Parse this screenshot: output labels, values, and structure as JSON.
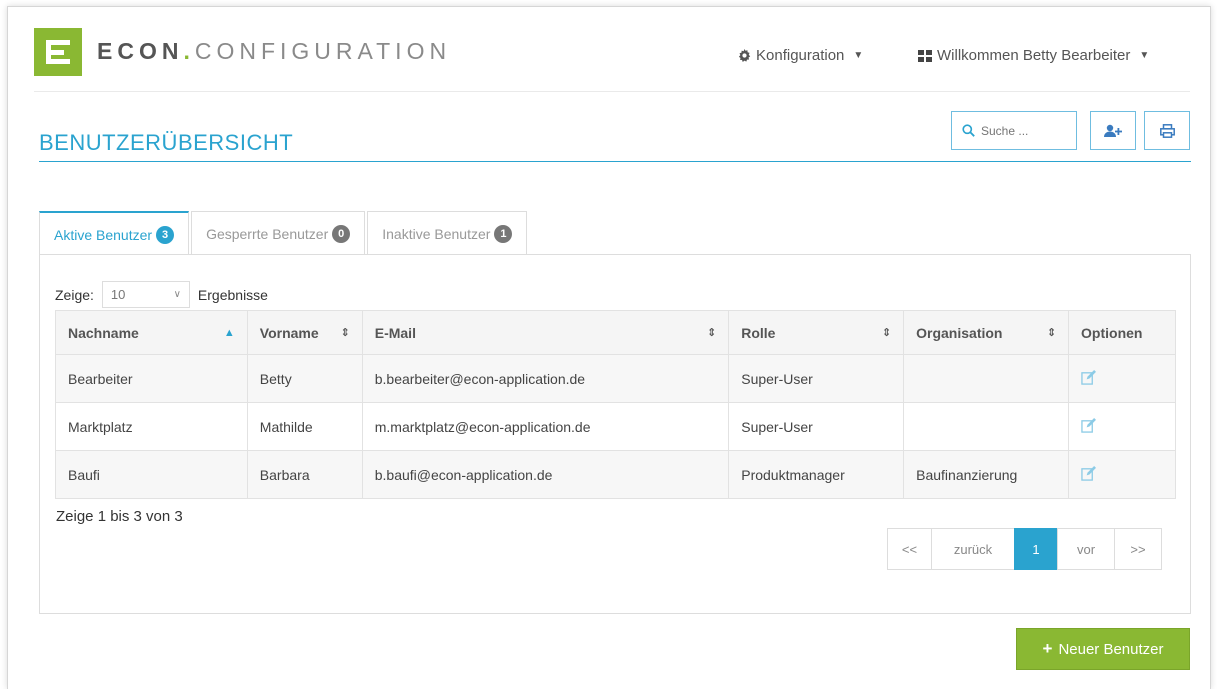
{
  "brand": {
    "part1": "ECON",
    "dot": ".",
    "part2": "CONFIGURATION",
    "accent": "#8ab833"
  },
  "topnav": {
    "config_label": "Konfiguration",
    "welcome_label": "Willkommen Betty Bearbeiter"
  },
  "page": {
    "title": "BENUTZERÜBERSICHT",
    "accent": "#2aa3cf"
  },
  "search": {
    "placeholder": "Suche ..."
  },
  "tabs": [
    {
      "label": "Aktive Benutzer",
      "count": "3"
    },
    {
      "label": "Gesperrte Benutzer",
      "count": "0"
    },
    {
      "label": "Inaktive Benutzer",
      "count": "1"
    }
  ],
  "length": {
    "prefix": "Zeige:",
    "value": "10",
    "suffix": "Ergebnisse"
  },
  "table": {
    "headers": [
      "Nachname",
      "Vorname",
      "E-Mail",
      "Rolle",
      "Organisation",
      "Optionen"
    ],
    "rows": [
      [
        "Bearbeiter",
        "Betty",
        "b.bearbeiter@econ-application.de",
        "Super-User",
        ""
      ],
      [
        "Marktplatz",
        "Mathilde",
        "m.marktplatz@econ-application.de",
        "Super-User",
        ""
      ],
      [
        "Baufi",
        "Barbara",
        "b.baufi@econ-application.de",
        "Produktmanager",
        "Baufinanzierung"
      ]
    ]
  },
  "summary": "Zeige 1 bis 3 von 3",
  "pagination": {
    "first": "<<",
    "prev": "zurück",
    "current": "1",
    "next": "vor",
    "last": ">>"
  },
  "new_user_label": "Neuer Benutzer"
}
